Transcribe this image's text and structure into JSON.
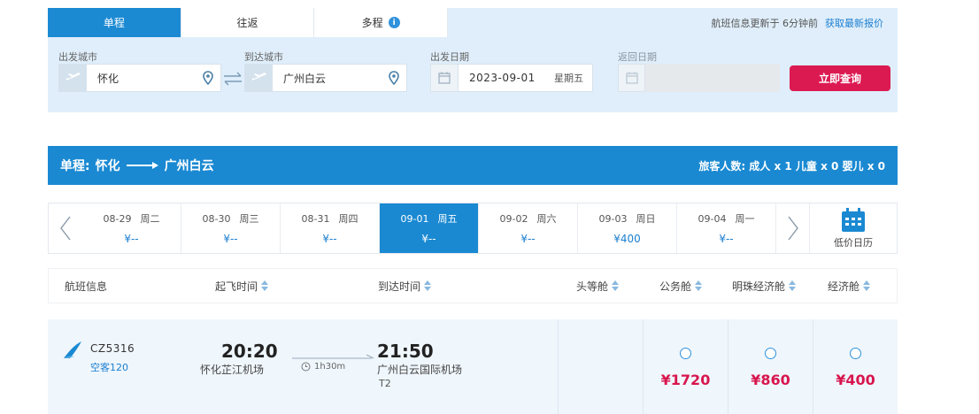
{
  "tabs": [
    {
      "label": "单程",
      "active": true
    },
    {
      "label": "往返",
      "active": false
    },
    {
      "label": "多程",
      "active": false
    }
  ],
  "update_note": {
    "text": "航班信息更新于 6分钟前",
    "link": "获取最新报价"
  },
  "search": {
    "from_label": "出发城市",
    "from_value": "怀化",
    "to_label": "到达城市",
    "to_value": "广州白云",
    "depart_label": "出发日期",
    "depart_date": "2023-09-01",
    "depart_weekday": "星期五",
    "return_label": "返回日期",
    "submit_label": "立即查询"
  },
  "route": {
    "trip_type": "单程:",
    "from": "怀化",
    "to": "广州白云",
    "passengers": "旅客人数: 成人 x 1 儿童 x 0 婴儿 x 0"
  },
  "date_strip": {
    "days": [
      {
        "date": "08-29",
        "weekday": "周二",
        "price": "¥--",
        "active": false
      },
      {
        "date": "08-30",
        "weekday": "周三",
        "price": "¥--",
        "active": false
      },
      {
        "date": "08-31",
        "weekday": "周四",
        "price": "¥--",
        "active": false
      },
      {
        "date": "09-01",
        "weekday": "周五",
        "price": "¥--",
        "active": true
      },
      {
        "date": "09-02",
        "weekday": "周六",
        "price": "¥--",
        "active": false
      },
      {
        "date": "09-03",
        "weekday": "周日",
        "price": "¥400",
        "active": false
      },
      {
        "date": "09-04",
        "weekday": "周一",
        "price": "¥--",
        "active": false
      }
    ],
    "low_price_calendar": "低价日历"
  },
  "table_header": {
    "flight_info": "航班信息",
    "depart_time": "起飞时间",
    "arrive_time": "到达时间",
    "first_class": "头等舱",
    "business_class": "公务舱",
    "premium_economy": "明珠经济舱",
    "economy": "经济舱"
  },
  "flight": {
    "flight_no": "CZ5316",
    "aircraft": "空客120",
    "depart_time": "20:20",
    "depart_airport": "怀化芷江机场",
    "duration": "1h30m",
    "arrive_time": "21:50",
    "arrive_airport": "广州白云国际机场",
    "arrive_terminal": "T2",
    "prices": {
      "business": "¥1720",
      "premium_economy": "¥860",
      "economy": "¥400"
    }
  },
  "colors": {
    "primary_blue": "#1a89d2",
    "panel_bg": "#dfeefa",
    "accent_red": "#dc1a52",
    "price_red": "#d8164e"
  }
}
